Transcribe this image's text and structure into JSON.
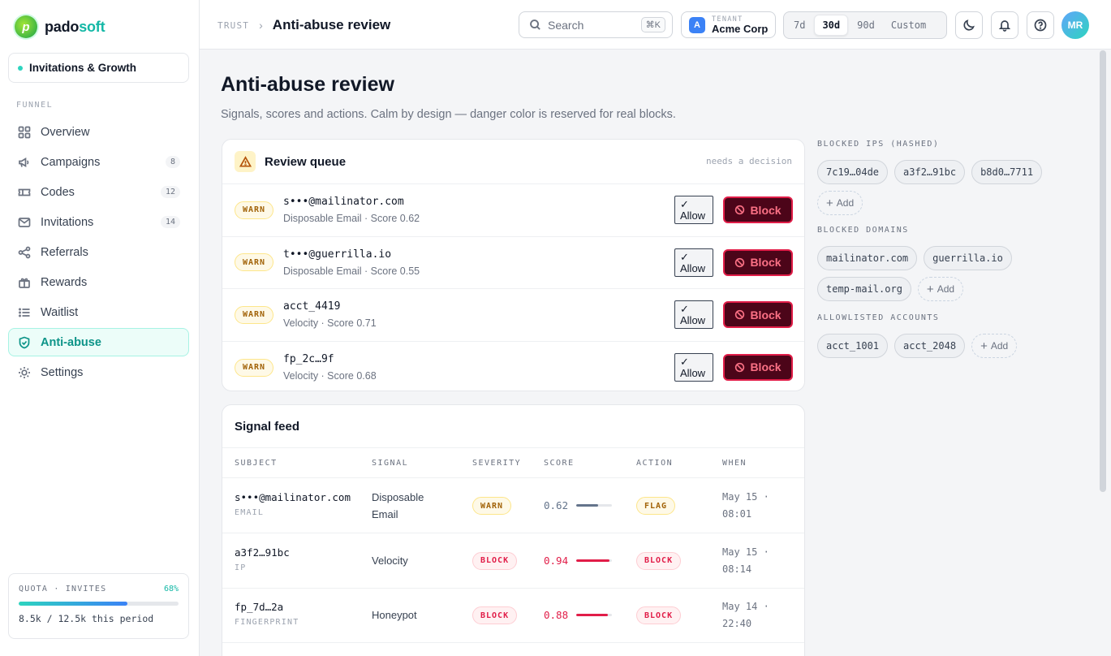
{
  "brand": {
    "name_a": "pado",
    "name_b": "soft"
  },
  "workspace": "Invitations & Growth",
  "sidebar": {
    "section": "FUNNEL",
    "items": [
      {
        "label": "Overview",
        "icon": "grid-icon"
      },
      {
        "label": "Campaigns",
        "icon": "megaphone-icon",
        "count": "8"
      },
      {
        "label": "Codes",
        "icon": "ticket-icon",
        "count": "12"
      },
      {
        "label": "Invitations",
        "icon": "mail-icon",
        "count": "14"
      },
      {
        "label": "Referrals",
        "icon": "share-icon"
      },
      {
        "label": "Rewards",
        "icon": "gift-icon"
      },
      {
        "label": "Waitlist",
        "icon": "list-icon"
      },
      {
        "label": "Anti-abuse",
        "icon": "shield-icon",
        "active": true
      },
      {
        "label": "Settings",
        "icon": "sun-icon"
      }
    ]
  },
  "quota": {
    "label": "QUOTA · INVITES",
    "pct_label": "68%",
    "fraction": 0.68,
    "text": "8.5k / 12.5k this period"
  },
  "topbar": {
    "crumb_parent": "TRUST",
    "crumb_title": "Anti-abuse review",
    "search_placeholder": "Search",
    "search_kbd": "⌘K",
    "tenant_label": "TENANT",
    "tenant_initial": "A",
    "tenant_name": "Acme Corp",
    "ranges": [
      "7d",
      "30d",
      "90d",
      "Custom"
    ],
    "range_selected": "30d",
    "avatar": "MR"
  },
  "page": {
    "title": "Anti-abuse review",
    "subtitle": "Signals, scores and actions. Calm by design — danger color is reserved for real blocks."
  },
  "review_queue": {
    "title": "Review queue",
    "note": "needs a decision",
    "allow_label": "Allow",
    "block_label": "Block",
    "items": [
      {
        "severity": "WARN",
        "subject": "s•••@mailinator.com",
        "meta": "Disposable Email · Score 0.62"
      },
      {
        "severity": "WARN",
        "subject": "t•••@guerrilla.io",
        "meta": "Disposable Email · Score 0.55"
      },
      {
        "severity": "WARN",
        "subject": "acct_4419",
        "meta": "Velocity · Score 0.71"
      },
      {
        "severity": "WARN",
        "subject": "fp_2c…9f",
        "meta": "Velocity · Score 0.68"
      }
    ]
  },
  "signal_feed": {
    "title": "Signal feed",
    "columns": [
      "SUBJECT",
      "SIGNAL",
      "SEVERITY",
      "SCORE",
      "ACTION",
      "WHEN"
    ],
    "rows": [
      {
        "subject": "s•••@mailinator.com",
        "type": "EMAIL",
        "signal_1": "Disposable",
        "signal_2": "Email",
        "severity": "WARN",
        "score": "0.62",
        "score_value": 0.62,
        "action": "FLAG",
        "when_1": "May 15 ·",
        "when_2": "08:01"
      },
      {
        "subject": "a3f2…91bc",
        "type": "IP",
        "signal_1": "Velocity",
        "signal_2": "",
        "severity": "BLOCK",
        "score": "0.94",
        "score_value": 0.94,
        "action": "BLOCK",
        "when_1": "May 15 ·",
        "when_2": "08:14"
      },
      {
        "subject": "fp_7d…2a",
        "type": "FINGERPRINT",
        "signal_1": "Honeypot",
        "signal_2": "",
        "severity": "BLOCK",
        "score": "0.88",
        "score_value": 0.88,
        "action": "BLOCK",
        "when_1": "May 14 ·",
        "when_2": "22:40"
      }
    ]
  },
  "right_panel": {
    "blocked_ips_label": "BLOCKED IPS (HASHED)",
    "blocked_ips": [
      "7c19…04de",
      "a3f2…91bc",
      "b8d0…7711"
    ],
    "blocked_domains_label": "BLOCKED DOMAINS",
    "blocked_domains": [
      "mailinator.com",
      "guerrilla.io",
      "temp-mail.org"
    ],
    "allowlisted_label": "ALLOWLISTED ACCOUNTS",
    "allowlisted": [
      "acct_1001",
      "acct_2048"
    ],
    "add_label": "Add"
  },
  "colors": {
    "accent": "#14b8a6",
    "danger": "#e11d48",
    "warn": "#a16207",
    "neutral_score": "#64748b"
  }
}
